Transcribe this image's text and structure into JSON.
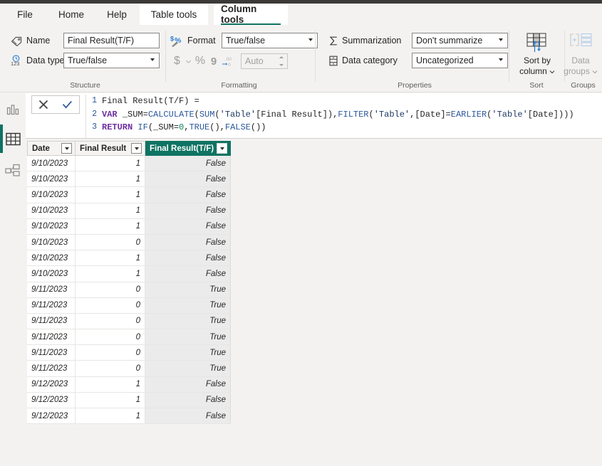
{
  "window": {
    "titlebar_color": "#3b3a39"
  },
  "ribbon_tabs": [
    {
      "label": "File",
      "active": false
    },
    {
      "label": "Home",
      "active": false
    },
    {
      "label": "Help",
      "active": false
    },
    {
      "label": "Table tools",
      "active": false
    },
    {
      "label": "Column tools",
      "active": true
    }
  ],
  "ribbon": {
    "structure": {
      "group_label": "Structure",
      "name_label": "Name",
      "name_value": "Final Result(T/F)",
      "data_type_label": "Data type",
      "data_type_value": "True/false"
    },
    "formatting": {
      "group_label": "Formatting",
      "format_label": "Format",
      "format_value": "True/false",
      "currency_icon": "$",
      "percent_icon": "%",
      "thousands_icon": "9",
      "decimal_icon": ".00",
      "decimals_value": "Auto"
    },
    "properties": {
      "group_label": "Properties",
      "summarization_label": "Summarization",
      "summarization_value": "Don't summarize",
      "data_category_label": "Data category",
      "data_category_value": "Uncategorized"
    },
    "sort": {
      "group_label": "Sort",
      "sort_by_column_label_1": "Sort by",
      "sort_by_column_label_2": "column"
    },
    "groups": {
      "group_label": "Groups",
      "data_groups_label_1": "Data",
      "data_groups_label_2": "groups"
    }
  },
  "left_rail": {
    "items": [
      {
        "name": "report-view",
        "selected": false
      },
      {
        "name": "data-view",
        "selected": true
      },
      {
        "name": "model-view",
        "selected": false
      }
    ]
  },
  "formula_bar": {
    "cancel_label": "✕",
    "commit_label": "✓",
    "lines": [
      {
        "number": "1",
        "text": "Final Result(T/F) ="
      },
      {
        "number": "2",
        "text": "VAR _SUM=CALCULATE(SUM('Table'[Final Result]),FILTER('Table',[Date]=EARLIER('Table'[Date])))"
      },
      {
        "number": "3",
        "text": "RETURN IF(_SUM=0,TRUE(),FALSE())"
      }
    ]
  },
  "table": {
    "columns": [
      {
        "label": "Date",
        "selected": false
      },
      {
        "label": "Final Result",
        "selected": false
      },
      {
        "label": "Final Result(T/F)",
        "selected": true
      }
    ],
    "rows": [
      [
        "9/10/2023",
        "1",
        "False"
      ],
      [
        "9/10/2023",
        "1",
        "False"
      ],
      [
        "9/10/2023",
        "1",
        "False"
      ],
      [
        "9/10/2023",
        "1",
        "False"
      ],
      [
        "9/10/2023",
        "1",
        "False"
      ],
      [
        "9/10/2023",
        "0",
        "False"
      ],
      [
        "9/10/2023",
        "1",
        "False"
      ],
      [
        "9/10/2023",
        "1",
        "False"
      ],
      [
        "9/11/2023",
        "0",
        "True"
      ],
      [
        "9/11/2023",
        "0",
        "True"
      ],
      [
        "9/11/2023",
        "0",
        "True"
      ],
      [
        "9/11/2023",
        "0",
        "True"
      ],
      [
        "9/11/2023",
        "0",
        "True"
      ],
      [
        "9/11/2023",
        "0",
        "True"
      ],
      [
        "9/12/2023",
        "1",
        "False"
      ],
      [
        "9/12/2023",
        "1",
        "False"
      ],
      [
        "9/12/2023",
        "1",
        "False"
      ]
    ]
  },
  "colors": {
    "accent_teal": "#0f7362",
    "ribbon_bg": "#f3f2f1",
    "selected_column_bg": "#ebebeb"
  }
}
